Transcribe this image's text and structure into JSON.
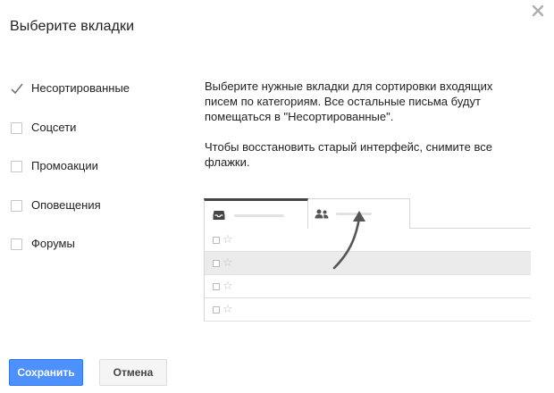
{
  "dialog": {
    "title": "Выберите вкладки",
    "close_icon": "close-icon"
  },
  "categories": [
    {
      "label": "Несортированные",
      "checked": true
    },
    {
      "label": "Соцсети",
      "checked": false
    },
    {
      "label": "Промоакции",
      "checked": false
    },
    {
      "label": "Оповещения",
      "checked": false
    },
    {
      "label": "Форумы",
      "checked": false
    }
  ],
  "description": {
    "paragraph_1": "Выберите нужные вкладки для сортировки входящих писем по категориям. Все остальные письма будут помещаться в \"Несортированные\".",
    "paragraph_2": "Чтобы восстановить старый интерфейс, снимите все флажки."
  },
  "preview": {
    "tabs": [
      {
        "icon": "inbox-icon",
        "active": true
      },
      {
        "icon": "people-icon",
        "active": false
      }
    ],
    "rows": [
      {
        "shaded": false
      },
      {
        "shaded": true
      },
      {
        "shaded": false
      },
      {
        "shaded": false
      }
    ]
  },
  "buttons": {
    "save_label": "Сохранить",
    "cancel_label": "Отмена"
  },
  "colors": {
    "primary_button": "#4d90fe",
    "checkmark": "#777777"
  }
}
